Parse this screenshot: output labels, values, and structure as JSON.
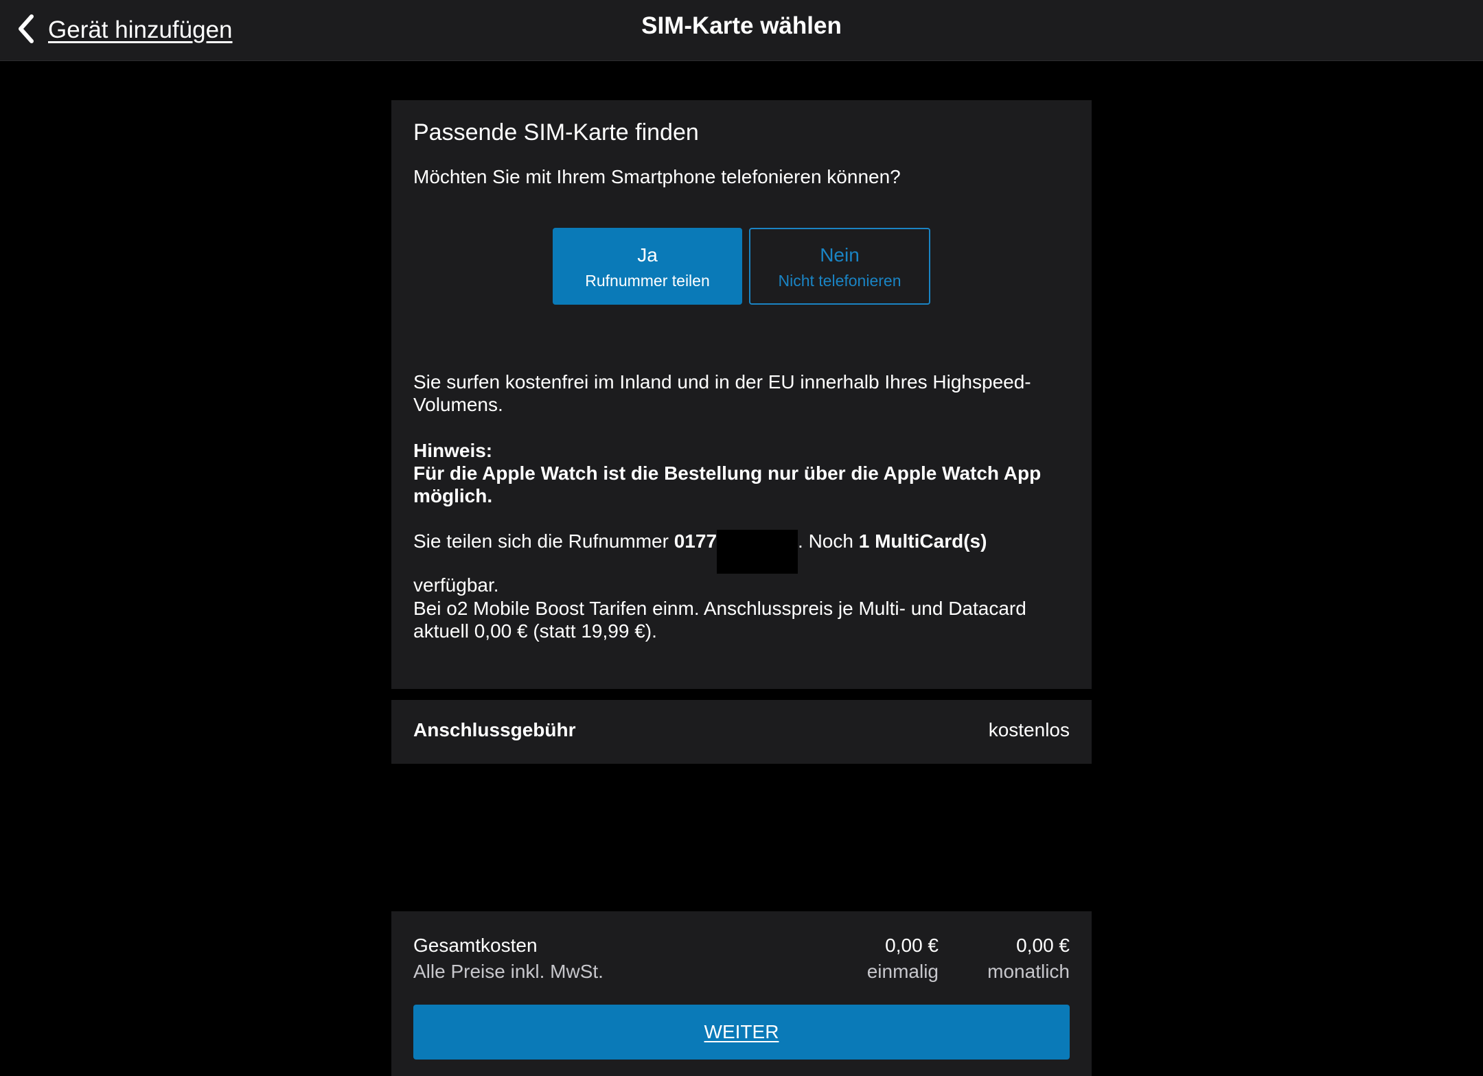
{
  "nav": {
    "back_label": "Gerät hinzufügen",
    "title": "SIM-Karte wählen",
    "back_icon": "chevron-left-icon"
  },
  "sim_card": {
    "heading": "Passende SIM-Karte finden",
    "question": "Möchten Sie mit Ihrem Smartphone telefonieren können?",
    "options": [
      {
        "title": "Ja",
        "subtitle": "Rufnummer teilen",
        "selected": true
      },
      {
        "title": "Nein",
        "subtitle": "Nicht telefonieren",
        "selected": false
      }
    ],
    "surf_text": "Sie surfen kostenfrei im Inland und in der EU innerhalb Ihres  Highspeed-Volumens.",
    "hint_title": "Hinweis:",
    "hint_text": "Für die Apple Watch ist die Bestellung nur über die Apple Watch App möglich.",
    "share_prefix": "Sie teilen sich die Rufnummer ",
    "share_number": "0177",
    "share_middle": ". Noch ",
    "share_count": "1 MultiCard(s)",
    "share_suffix": " verfügbar.",
    "boost_text": "Bei o2 Mobile Boost Tarifen einm. Anschlusspreis je Multi- und Datacard aktuell 0,00 € (statt 19,99 €)."
  },
  "fee": {
    "label": "Anschlussgebühr",
    "value": "kostenlos"
  },
  "totals": {
    "label": "Gesamtkosten",
    "note": "Alle Preise inkl. MwSt.",
    "once_value": "0,00 €",
    "once_caption": "einmalig",
    "monthly_value": "0,00 €",
    "monthly_caption": "monatlich",
    "button_label": "WEITER"
  },
  "colors": {
    "accent": "#0a7ab8",
    "panel": "#1c1c1e",
    "background": "#000000"
  }
}
